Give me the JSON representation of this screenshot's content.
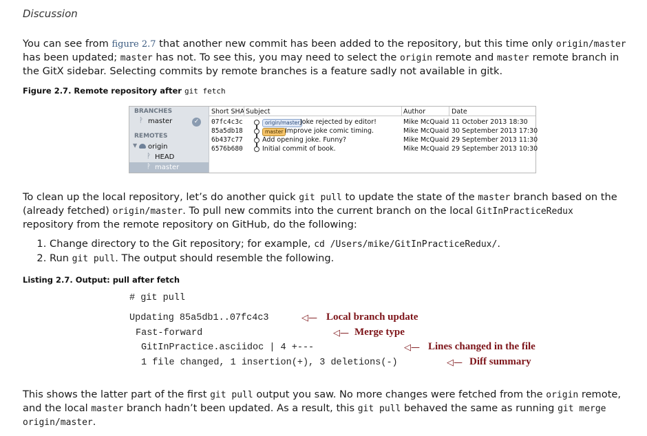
{
  "heading": "Discussion",
  "para1": {
    "t1": "You can see from ",
    "figref": "figure 2.7",
    "t2": " that another new commit has been added to the repository, but this time only ",
    "c1": "origin/master",
    "t3": "has been updated; ",
    "c2": "master",
    "t4": " has not. To see this, you may need to select the ",
    "c3": "origin",
    "t5": " remote and ",
    "c4": "master",
    "t6": " remote branch in",
    "t7": "the GitX sidebar. Selecting commits by remote branches is a feature sadly not available in gitk."
  },
  "figure_caption": {
    "text": "Figure 2.7. Remote repository after ",
    "code": "git fetch"
  },
  "screenshot": {
    "sidebar": {
      "branches_label": "BRANCHES",
      "master": "master",
      "remotes_label": "REMOTES",
      "origin": "origin",
      "head": "HEAD",
      "remote_master": "master"
    },
    "columns": [
      "Short SHA",
      "Subject",
      "Author",
      "Date"
    ],
    "rows": [
      {
        "sha": "07fc4c3c",
        "tag": "origin/master",
        "tag_kind": "remote",
        "subject": "Joke rejected by editor!",
        "author": "Mike McQuaid",
        "date": "11 October 2013 18:30"
      },
      {
        "sha": "85a5db18",
        "tag": "master",
        "tag_kind": "local",
        "subject": "Improve joke comic timing.",
        "author": "Mike McQuaid",
        "date": "30 September 2013 17:30"
      },
      {
        "sha": "6b437c77",
        "tag": "",
        "tag_kind": "",
        "subject": "Add opening joke. Funny?",
        "author": "Mike McQuaid",
        "date": "29 September 2013 11:30"
      },
      {
        "sha": "6576b680",
        "tag": "",
        "tag_kind": "",
        "subject": "Initial commit of book.",
        "author": "Mike McQuaid",
        "date": "29 September 2013 10:30"
      }
    ]
  },
  "para2": {
    "t1": "To clean up the local repository, let’s do another quick ",
    "c1": "git pull",
    "t2": " to update the state of the ",
    "c2": "master",
    "t3": " branch based on the",
    "t4": "(already fetched) ",
    "c3": "origin/master",
    "t5": ". To pull new commits into the current branch on the local ",
    "c4": "GitInPracticeRedux",
    "t6": "repository from the remote repository on GitHub, do the following:"
  },
  "steps": [
    {
      "text": "Change directory to the Git repository; for example, ",
      "code": "cd /Users/mike/GitInPracticeRedux/",
      "after": "."
    },
    {
      "text": "Run ",
      "code": "git pull",
      "after": ". The output should resemble the following."
    }
  ],
  "listing_caption": "Listing 2.7. Output: pull after fetch",
  "listing": {
    "line1": "# git pull",
    "line2": "Updating 85a5db1..07fc4c3",
    "line3": "Fast-forward",
    "line4": "GitInPractice.asciidoc | 4 +---",
    "line5": "1 file changed, 1 insertion(+), 3 deletions(-)",
    "anno1": "Local branch update",
    "anno2": "Merge type",
    "anno3": "Lines changed in the file",
    "anno4": "Diff summary"
  },
  "para3": {
    "t1": "This shows the latter part of the first ",
    "c1": "git pull",
    "t2": " output you saw. No more changes were fetched from the ",
    "c2": "origin",
    "t3": " remote,",
    "t4": "and the local ",
    "c3": "master",
    "t5": " branch hadn’t been updated. As a result, this ",
    "c4": "git pull",
    "t6": " behaved the same as running ",
    "c5": "git merge",
    "c6": "origin/master",
    "t7": "."
  }
}
